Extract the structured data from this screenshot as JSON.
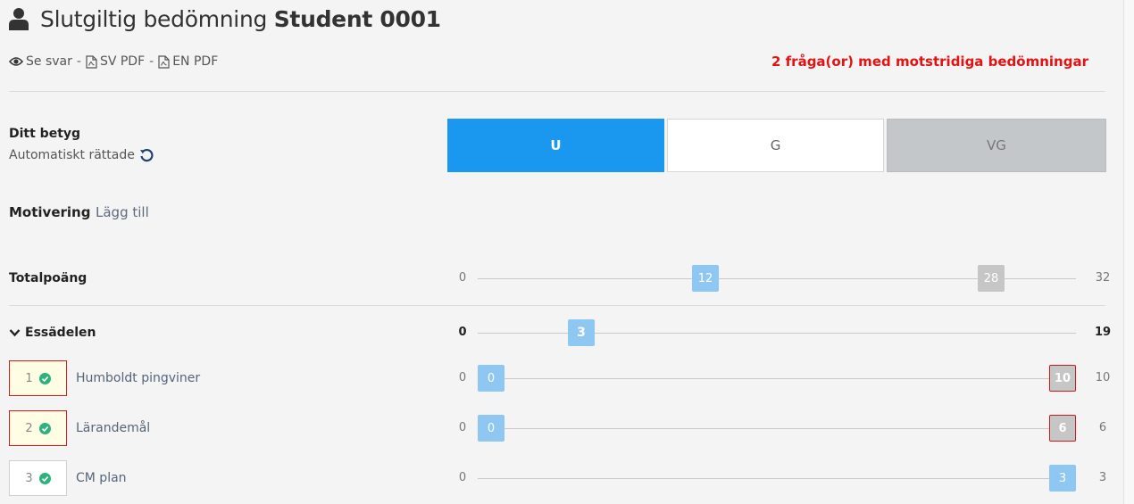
{
  "header": {
    "title_prefix": "Slutgiltig bedömning",
    "student_name": "Student 0001",
    "user_icon": "user-icon"
  },
  "links": {
    "see_answers": "Se svar",
    "sv_pdf": "SV PDF",
    "en_pdf": "EN PDF",
    "separator": "-"
  },
  "conflict_message": "2 fråga(or) med motstridiga bedömningar",
  "grade": {
    "title": "Ditt betyg",
    "subtitle": "Automatiskt rättade",
    "options": [
      {
        "label": "U",
        "state": "selected"
      },
      {
        "label": "G",
        "state": "available"
      },
      {
        "label": "VG",
        "state": "disabled"
      }
    ],
    "colors": {
      "selected": "#1a98f0",
      "disabled": "#c4c7c9"
    }
  },
  "motivation": {
    "label": "Motivering",
    "add_link": "Lägg till"
  },
  "total": {
    "label": "Totalpoäng",
    "min": "0",
    "max": "32",
    "score": "12",
    "threshold": "28"
  },
  "section": {
    "label": "Essädelen",
    "min": "0",
    "max": "19",
    "score": "3"
  },
  "questions": [
    {
      "number": "1",
      "title": "Humboldt pingviner",
      "min": "0",
      "max": "10",
      "score": "0",
      "other_score": "10",
      "conflict": true
    },
    {
      "number": "2",
      "title": "Lärandemål",
      "min": "0",
      "max": "6",
      "score": "0",
      "other_score": "6",
      "conflict": true
    },
    {
      "number": "3",
      "title": "CM plan",
      "min": "0",
      "max": "3",
      "score": "3",
      "conflict": false
    }
  ]
}
